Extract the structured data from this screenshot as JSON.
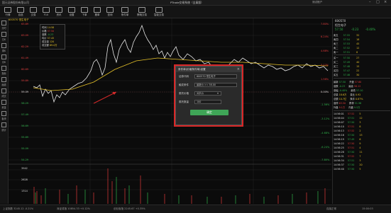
{
  "window": {
    "title": "PTrade交易系统（全真版）",
    "left_title": "国元证券股份有限公司",
    "user": "测试账户"
  },
  "toolbar": {
    "buttons": [
      {
        "label": "行情",
        "icon": "quotes-icon"
      },
      {
        "label": "自选",
        "icon": "watchlist-icon"
      },
      {
        "label": "交易",
        "icon": "trade-icon"
      },
      {
        "label": "F10",
        "icon": "f10-icon"
      },
      {
        "label": "资讯",
        "icon": "news-icon"
      },
      {
        "label": "设置",
        "icon": "settings-icon"
      },
      {
        "label": "下单",
        "icon": "order-icon"
      },
      {
        "label": "撤单",
        "icon": "cancel-icon"
      },
      {
        "label": "查询",
        "icon": "query-icon"
      }
    ],
    "wide_buttons": [
      "条件单",
      "策略交易",
      "智能交易"
    ]
  },
  "leftbar": {
    "items": [
      "分时",
      "日K",
      "周K",
      "月K",
      "指标",
      "画线",
      "成交",
      "资金",
      "板块",
      "统计"
    ]
  },
  "chart": {
    "left_axis": [
      "63.89",
      "63.09",
      "62.29",
      "61.49",
      "60.69",
      "59.89",
      "59.09",
      "58.29",
      "57.49",
      "56.69",
      "55.89",
      "55.09",
      "54.29",
      "53.49",
      "52.69",
      "51.89"
    ],
    "right_axis": [
      "7.80%",
      "6.24%",
      "4.68%",
      "3.12%",
      "1.56%",
      "0.00%",
      "-1.56%",
      "-3.12%",
      "-4.68%",
      "-6.24%",
      "-7.80%"
    ],
    "vol_axis": [
      "3942",
      "2628",
      "1314"
    ],
    "times": [
      "09:30",
      "10:30",
      "11:30/13:00",
      "14:00",
      "15:00"
    ],
    "info_rows": [
      [
        "时间",
        "14:58"
      ],
      [
        "价格",
        "57.50"
      ],
      [
        "涨跌",
        "-0.23"
      ],
      [
        "均价",
        "57.45"
      ],
      [
        "成交量",
        "120"
      ],
      [
        "成交额",
        "69.0万"
      ]
    ]
  },
  "dialog": {
    "title": "条件单(价格条件单)设置",
    "fields": [
      {
        "label": "证券代码",
        "value": "600570 恒生电子"
      },
      {
        "label": "触发条件",
        "value": "最新价 >= 58.00"
      },
      {
        "label": "委托价格",
        "value": "对手价"
      },
      {
        "label": "委托数量",
        "value": "100"
      }
    ],
    "confirm_label": "确定"
  },
  "quote": {
    "code": "600570",
    "name": "恒生电子",
    "price": "57.50",
    "change": "-0.23",
    "pct": "-0.40%",
    "sell": [
      [
        "卖五",
        "57.55",
        "32"
      ],
      [
        "卖四",
        "57.54",
        "18"
      ],
      [
        "卖三",
        "57.53",
        "45"
      ],
      [
        "卖二",
        "57.52",
        "12"
      ],
      [
        "卖一",
        "57.51",
        "8"
      ]
    ],
    "buy": [
      [
        "买一",
        "57.50",
        "27"
      ],
      [
        "买二",
        "57.49",
        "40"
      ],
      [
        "买三",
        "57.48",
        "15"
      ],
      [
        "买四",
        "57.47",
        "22"
      ],
      [
        "买五",
        "57.46",
        "30"
      ]
    ],
    "stats": [
      [
        "最新",
        "57.50",
        "开盘",
        "57.60"
      ],
      [
        "涨跌",
        "-0.23",
        "最高",
        "58.12"
      ],
      [
        "涨幅",
        "-0.40%",
        "最低",
        "57.10"
      ],
      [
        "总量",
        "18.6万",
        "量比",
        "0.92"
      ],
      [
        "总额",
        "10.7亿",
        "换手",
        "0.87%"
      ],
      [
        "涨停",
        "63.50",
        "跌停",
        "51.96"
      ],
      [
        "外盘",
        "9.1万",
        "内盘",
        "9.5万"
      ]
    ],
    "ticks": [
      [
        "14:56:01",
        "57.52",
        "5"
      ],
      [
        "14:56:04",
        "57.51",
        "12"
      ],
      [
        "14:56:07",
        "57.50",
        "3"
      ],
      [
        "14:56:10",
        "57.51",
        "8"
      ],
      [
        "14:56:13",
        "57.52",
        "2"
      ],
      [
        "14:56:16",
        "57.50",
        "15"
      ],
      [
        "14:56:19",
        "57.49",
        "6"
      ],
      [
        "14:56:22",
        "57.50",
        "9"
      ],
      [
        "14:56:25",
        "57.51",
        "4"
      ],
      [
        "14:56:28",
        "57.50",
        "11"
      ],
      [
        "14:56:31",
        "57.52",
        "7"
      ],
      [
        "14:56:34",
        "57.51",
        "3"
      ],
      [
        "14:56:37",
        "57.50",
        "20"
      ],
      [
        "14:56:40",
        "57.50",
        "5"
      ]
    ]
  },
  "status": {
    "items": [
      "上证指数 3245.12 -0.21%",
      "深证成指 10854.33 +0.12%",
      "创业板指 2245.67 +0.35%",
      "连接正常",
      "15:00:03"
    ]
  }
}
